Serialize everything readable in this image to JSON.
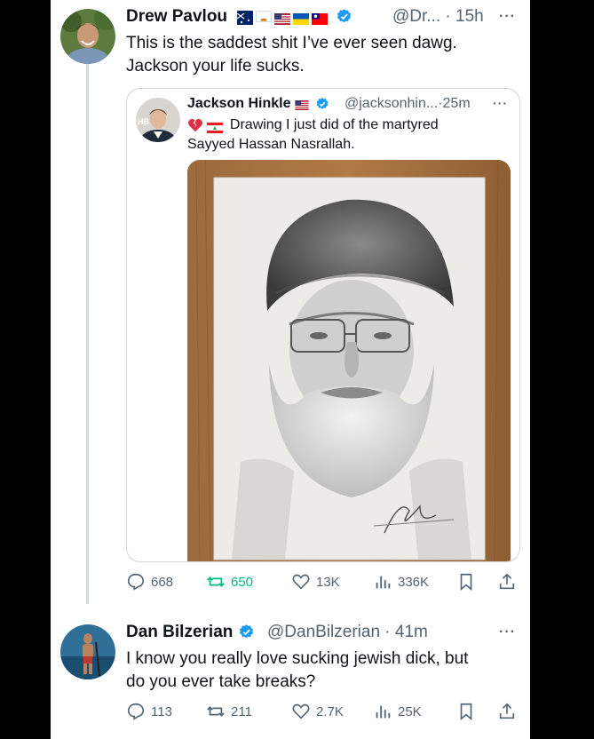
{
  "tweet1": {
    "name": "Drew Pavlou",
    "flags": [
      "australia-flag",
      "cyprus-flag",
      "usa-flag",
      "ukraine-flag",
      "taiwan-flag"
    ],
    "handle": "@Dr...",
    "time": "15h",
    "text_line1": "This is the saddest shit I’ve ever seen dawg.",
    "text_line2": "Jackson your life sucks.",
    "more": "···"
  },
  "quote": {
    "name": "Jackson Hinkle",
    "flags": [
      "usa-flag"
    ],
    "handle": "@jacksonhin...",
    "time": "25m",
    "text_line1": "Drawing I just did of the martyred",
    "text_line2": "Sayyed Hassan Nasrallah.",
    "emoji": [
      "broken-heart-icon",
      "lebanon-flag"
    ],
    "more": "···",
    "avatar_badge": "HB"
  },
  "tweet1_actions": {
    "replies": "668",
    "retweets": "650",
    "likes": "13K",
    "views": "336K"
  },
  "tweet2": {
    "name": "Dan Bilzerian",
    "handle": "@DanBilzerian",
    "time": "41m",
    "text_line1": "I know you really love sucking jewish dick, but",
    "text_line2": "do you ever take breaks?",
    "more": "···"
  },
  "tweet2_actions": {
    "replies": "113",
    "retweets": "211",
    "likes": "2.7K",
    "views": "25K"
  },
  "colors": {
    "text": "#0f1419",
    "secondary": "#536471",
    "verified": "#1d9bf0",
    "retweet_active": "#00ba7c",
    "border": "#cfd9de"
  }
}
